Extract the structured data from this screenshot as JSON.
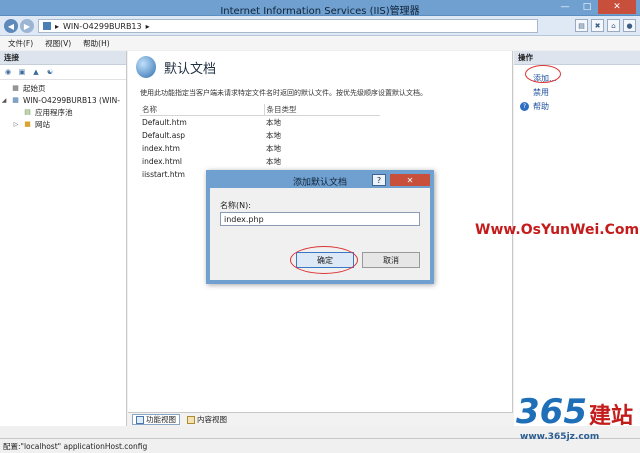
{
  "window": {
    "title": "Internet Information Services (IIS)管理器"
  },
  "address": {
    "path": "WIN-O4299BURB13",
    "separator": "▸"
  },
  "menu": {
    "items": [
      "文件(F)",
      "视图(V)",
      "帮助(H)"
    ]
  },
  "connections": {
    "header": "连接",
    "tree": [
      {
        "label": "起始页",
        "level": 0
      },
      {
        "label": "WIN-O4299BURB13 (WIN-",
        "level": 0
      },
      {
        "label": "应用程序池",
        "level": 1
      },
      {
        "label": "网站",
        "level": 1
      }
    ]
  },
  "main": {
    "title": "默认文档",
    "description": "使用此功能指定当客户端未请求特定文件名时返回的默认文件。按优先级顺序设置默认文档。",
    "columns": [
      "名称",
      "条目类型"
    ],
    "rows": [
      {
        "name": "Default.htm",
        "type": "本地"
      },
      {
        "name": "Default.asp",
        "type": "本地"
      },
      {
        "name": "index.htm",
        "type": "本地"
      },
      {
        "name": "index.html",
        "type": "本地"
      },
      {
        "name": "iisstart.htm",
        "type": "本地"
      }
    ],
    "tabs": [
      "功能视图",
      "内容视图"
    ]
  },
  "actions": {
    "header": "操作",
    "items": [
      "添加...",
      "禁用",
      "帮助"
    ]
  },
  "status": {
    "text": "配置:\"localhost\" applicationHost.config"
  },
  "dialog": {
    "title": "添加默认文档",
    "help": "?",
    "label": "名称(N):",
    "value": "index.php",
    "ok": "确定",
    "cancel": "取消"
  },
  "watermark": {
    "text": "Www.OsYunWei.Com"
  },
  "logo": {
    "num": "365",
    "cn": "建站",
    "url": "www.365jz.com"
  }
}
